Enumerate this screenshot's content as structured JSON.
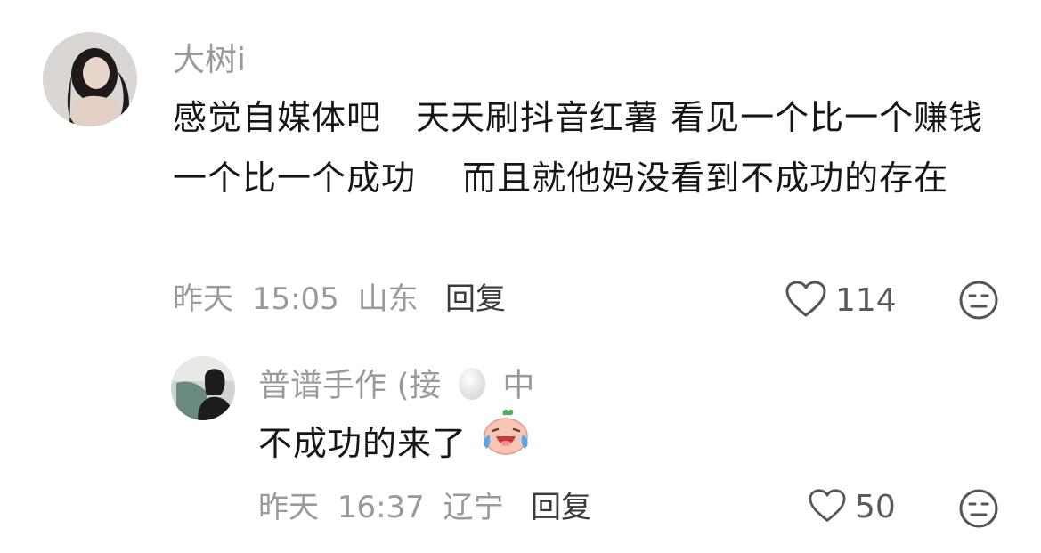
{
  "comments": [
    {
      "username": "大树i",
      "text": "感觉自媒体吧　天天刷抖音红薯  看见一个比一个赚钱一个比一个成功　 而且就他妈没看到不成功的存在",
      "date": "昨天",
      "time": "15:05",
      "location": "山东",
      "reply_label": "回复",
      "likes": "114",
      "icons": {
        "like": "heart-outline-icon",
        "dislike": "meh-face-icon"
      }
    }
  ],
  "reply": {
    "username_prefix": "普谱手作 (接",
    "username_emoji": "egg-emoji",
    "username_suffix": "中",
    "text": "不成功的来了",
    "text_emoji": "crying-laughing-sticker",
    "date": "昨天",
    "time": "16:37",
    "location": "辽宁",
    "reply_label": "回复",
    "likes": "50",
    "icons": {
      "like": "heart-outline-icon",
      "dislike": "meh-face-icon"
    }
  }
}
